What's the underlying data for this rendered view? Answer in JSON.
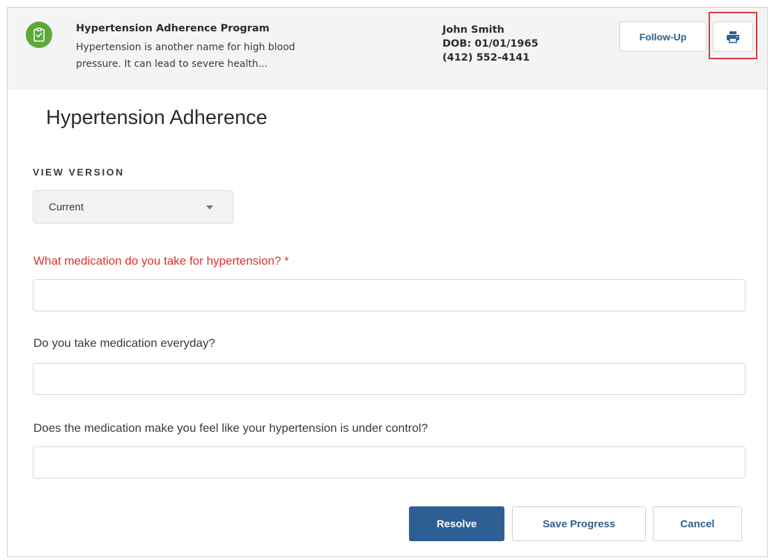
{
  "header": {
    "program_title": "Hypertension Adherence Program",
    "program_description_line1": "Hypertension is another name for high blood",
    "program_description_line2": "pressure. It can lead to severe health...",
    "logo_icon": "clipboard-icon",
    "patient": {
      "name": "John Smith",
      "dob": "DOB: 01/01/1965",
      "phone": "(412) 552-4141"
    },
    "follow_up_label": "Follow-Up",
    "print_icon": "print-icon",
    "highlight_color": "#d23a3a"
  },
  "main": {
    "title": "Hypertension Adherence",
    "view_version_label": "VIEW VERSION",
    "view_version_value": "Current",
    "questions": [
      {
        "label": "What medication do you take for hypertension? *",
        "required": true,
        "value": ""
      },
      {
        "label": "Do you take medication everyday?",
        "required": false,
        "value": ""
      },
      {
        "label": "Does the medication make you feel like your hypertension is under control?",
        "required": false,
        "value": ""
      }
    ]
  },
  "actions": {
    "resolve_label": "Resolve",
    "save_progress_label": "Save Progress",
    "cancel_label": "Cancel",
    "primary_color": "#2d5f94"
  }
}
